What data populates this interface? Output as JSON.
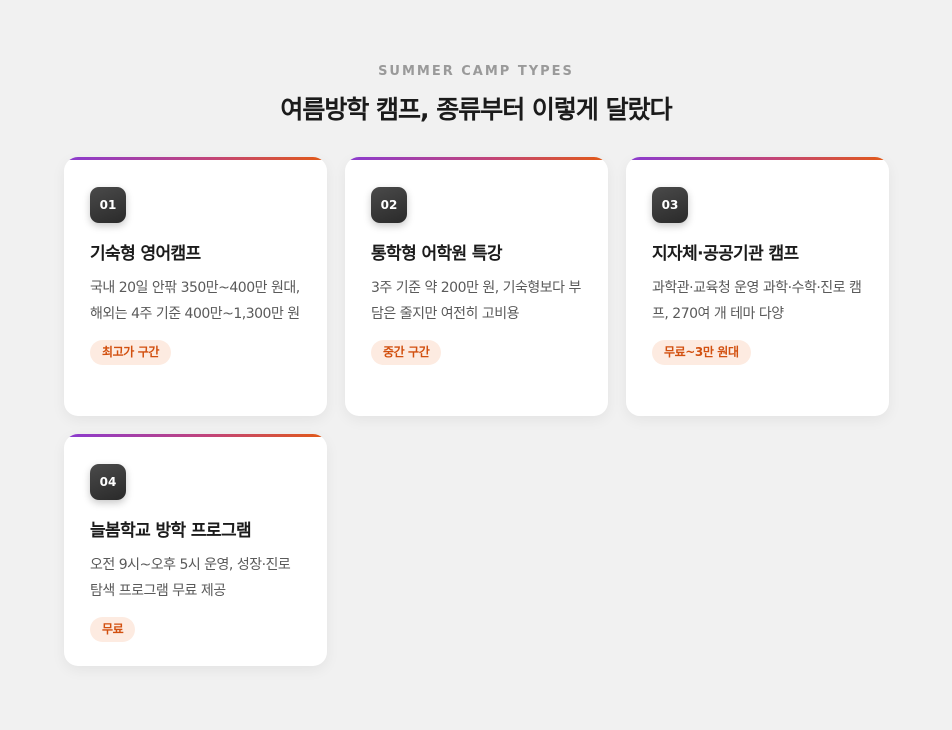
{
  "header": {
    "eyebrow": "SUMMER CAMP TYPES",
    "title": "여름방학 캠프, 종류부터 이렇게 달랐다"
  },
  "colors": {
    "accent_gradient": [
      "#8a3bd1",
      "#c2447a",
      "#e25a16"
    ],
    "badge_text": "#d2500f",
    "badge_bg": "#fdebe1"
  },
  "cards": [
    {
      "number": "01",
      "title": "기숙형 영어캠프",
      "description": "국내 20일 안팎 350만~400만 원대, 해외는 4주 기준 400만~1,300만 원",
      "badge": "최고가 구간"
    },
    {
      "number": "02",
      "title": "통학형 어학원 특강",
      "description": "3주 기준 약 200만 원, 기숙형보다 부담은 줄지만 여전히 고비용",
      "badge": "중간 구간"
    },
    {
      "number": "03",
      "title": "지자체·공공기관 캠프",
      "description": "과학관·교육청 운영 과학·수학·진로 캠프, 270여 개 테마 다양",
      "badge": "무료~3만 원대"
    },
    {
      "number": "04",
      "title": "늘봄학교 방학 프로그램",
      "description": "오전 9시~오후 5시 운영, 성장·진로 탐색 프로그램 무료 제공",
      "badge": "무료"
    }
  ]
}
